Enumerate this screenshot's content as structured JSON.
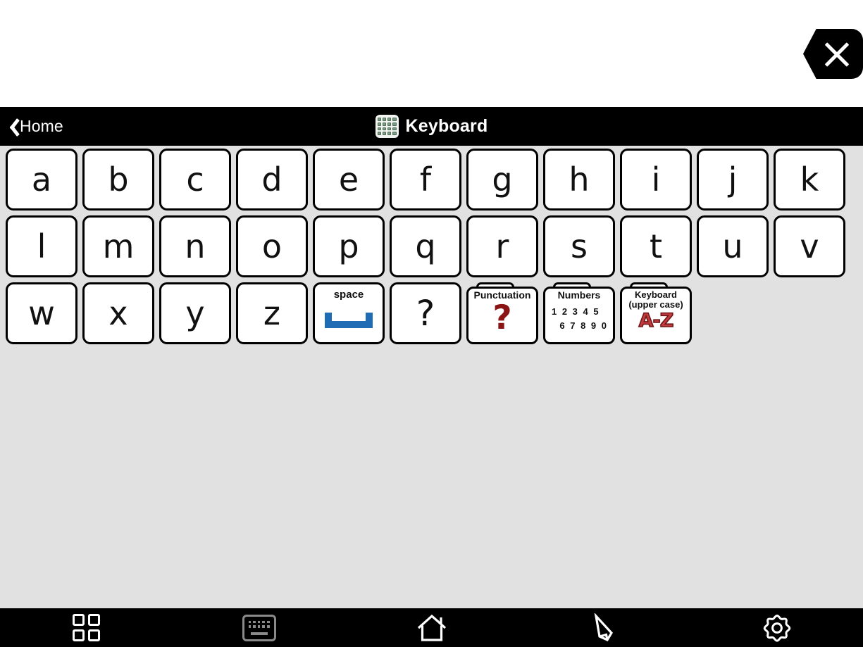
{
  "window": {
    "close_button_label": "×",
    "background_color": "#E1E1E1",
    "header_background": "#000000"
  },
  "header": {
    "back_label": "Home",
    "title": "Keyboard",
    "icon": "keyboard-grid-icon"
  },
  "keyboard": {
    "rows": [
      {
        "keys": [
          {
            "type": "letter",
            "label": "a"
          },
          {
            "type": "letter",
            "label": "b"
          },
          {
            "type": "letter",
            "label": "c"
          },
          {
            "type": "letter",
            "label": "d"
          },
          {
            "type": "letter",
            "label": "e"
          },
          {
            "type": "letter",
            "label": "f"
          },
          {
            "type": "letter",
            "label": "g"
          },
          {
            "type": "letter",
            "label": "h"
          },
          {
            "type": "letter",
            "label": "i"
          },
          {
            "type": "letter",
            "label": "j"
          },
          {
            "type": "letter",
            "label": "k"
          }
        ]
      },
      {
        "keys": [
          {
            "type": "letter",
            "label": "l"
          },
          {
            "type": "letter",
            "label": "m"
          },
          {
            "type": "letter",
            "label": "n"
          },
          {
            "type": "letter",
            "label": "o"
          },
          {
            "type": "letter",
            "label": "p"
          },
          {
            "type": "letter",
            "label": "q"
          },
          {
            "type": "letter",
            "label": "r"
          },
          {
            "type": "letter",
            "label": "s"
          },
          {
            "type": "letter",
            "label": "t"
          },
          {
            "type": "letter",
            "label": "u"
          },
          {
            "type": "letter",
            "label": "v"
          }
        ]
      },
      {
        "keys": [
          {
            "type": "letter",
            "label": "w"
          },
          {
            "type": "letter",
            "label": "x"
          },
          {
            "type": "letter",
            "label": "y"
          },
          {
            "type": "letter",
            "label": "z"
          },
          {
            "type": "space",
            "label": "space"
          },
          {
            "type": "letter",
            "label": "?"
          },
          {
            "type": "folder",
            "label": "Punctuation"
          },
          {
            "type": "folder",
            "label": "Numbers"
          },
          {
            "type": "folder",
            "label": "Keyboard (upper case)"
          },
          {
            "type": "blank",
            "label": ""
          },
          {
            "type": "blank",
            "label": ""
          }
        ]
      }
    ],
    "space_key": {
      "caption": "space",
      "bar_color": "#1F6CB4"
    },
    "question_key": {
      "glyph": "?"
    },
    "punctuation_key": {
      "caption": "Punctuation",
      "glyph": "?",
      "glyph_color": "#8B1515"
    },
    "numbers_key": {
      "caption": "Numbers",
      "line1": "1 2 3 4 5",
      "line2": "6 7 8 9 0"
    },
    "uppercase_key": {
      "caption_line1": "Keyboard",
      "caption_line2": "(upper case)",
      "glyph": "A-Z",
      "glyph_color": "#C33B3F"
    }
  },
  "bottom_nav": {
    "items": [
      {
        "name": "grid",
        "icon": "grid-icon",
        "active": true
      },
      {
        "name": "keyboard",
        "icon": "keyboard-icon",
        "active": false
      },
      {
        "name": "home",
        "icon": "home-icon",
        "active": true
      },
      {
        "name": "edit",
        "icon": "pencil-icon",
        "active": true
      },
      {
        "name": "settings",
        "icon": "gear-icon",
        "active": true
      }
    ]
  }
}
